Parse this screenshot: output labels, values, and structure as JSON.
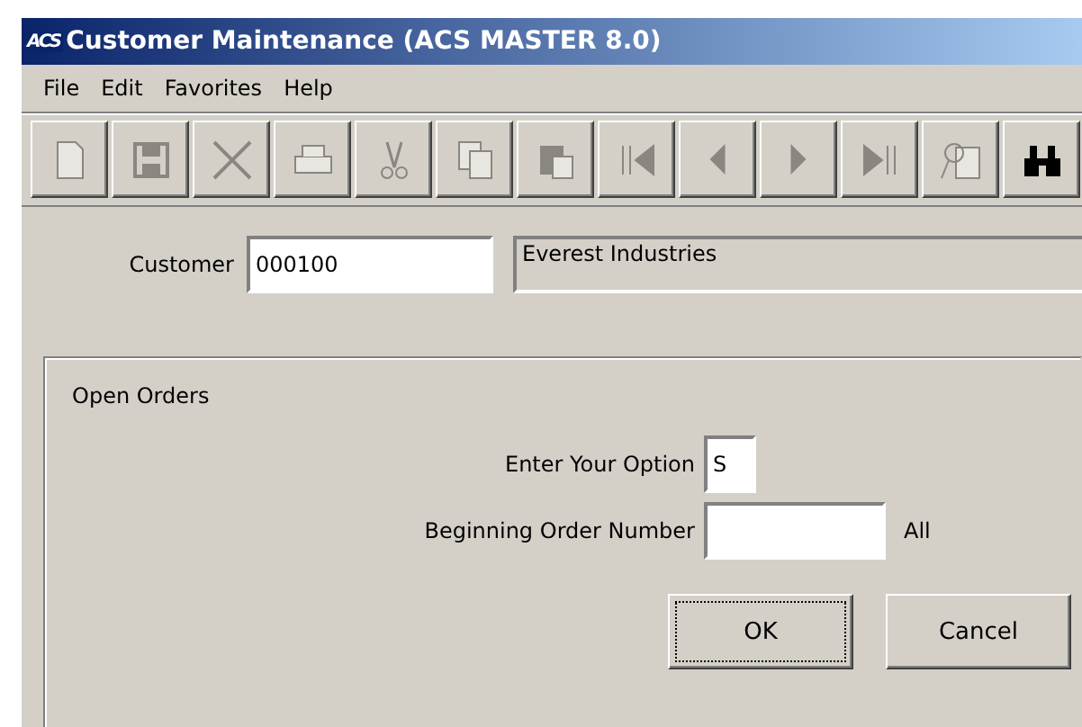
{
  "window": {
    "logo": "ACS",
    "title": "Customer Maintenance (ACS MASTER 8.0)"
  },
  "menu": [
    "File",
    "Edit",
    "Favorites",
    "Help"
  ],
  "toolbar": [
    {
      "kind": "new",
      "disabled": true
    },
    {
      "kind": "save",
      "disabled": true
    },
    {
      "kind": "delete",
      "disabled": true
    },
    {
      "kind": "print",
      "disabled": true
    },
    {
      "kind": "cut",
      "disabled": true
    },
    {
      "kind": "copy",
      "disabled": true
    },
    {
      "kind": "paste",
      "disabled": true
    },
    {
      "kind": "first",
      "disabled": true
    },
    {
      "kind": "prev",
      "disabled": true
    },
    {
      "kind": "next",
      "disabled": true
    },
    {
      "kind": "last",
      "disabled": true
    },
    {
      "kind": "lookup",
      "disabled": true
    },
    {
      "kind": "find",
      "disabled": false
    }
  ],
  "customer": {
    "label": "Customer",
    "value": "000100",
    "name": "Everest Industries"
  },
  "panel": {
    "title": "Open Orders",
    "option_label": "Enter Your Option",
    "option_value": "S",
    "begin_label": "Beginning Order Number",
    "begin_hint": "All"
  },
  "buttons": [
    {
      "label": "OK",
      "focused": true
    },
    {
      "label": "Cancel",
      "focused": false
    }
  ]
}
